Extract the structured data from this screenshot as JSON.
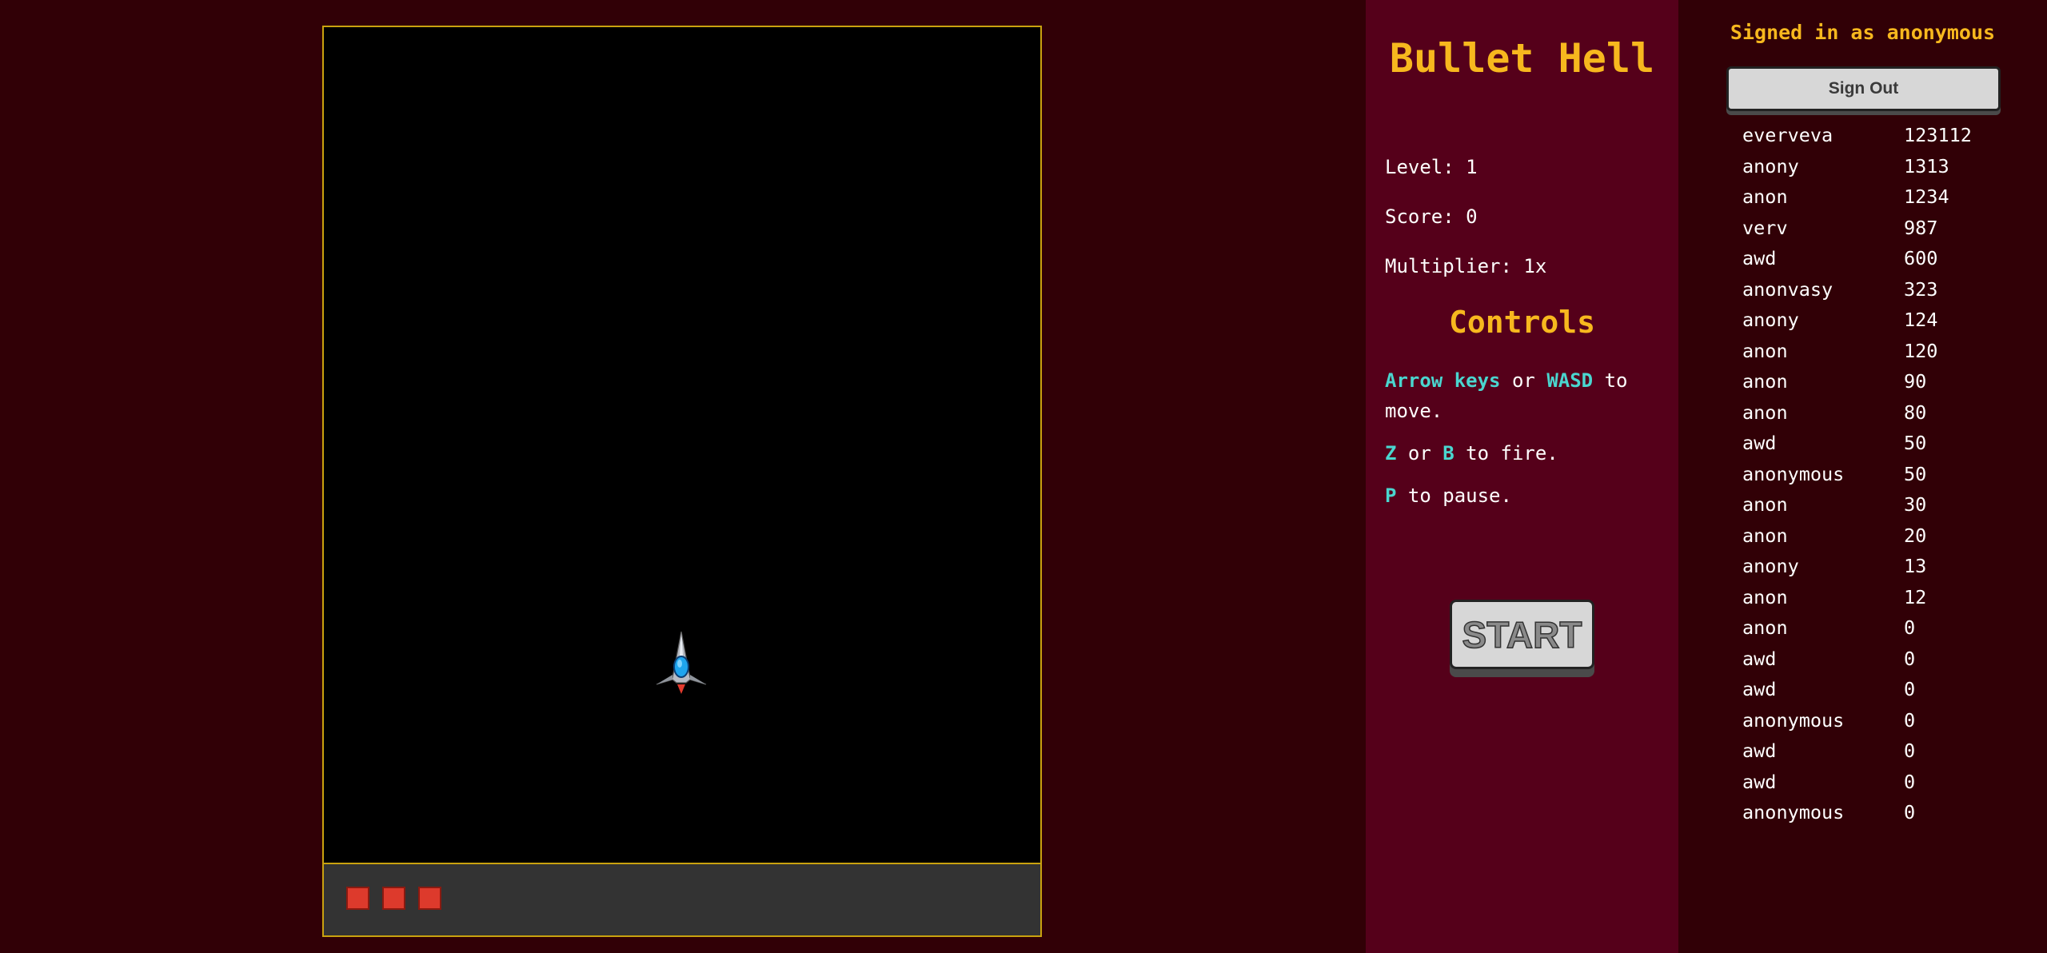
{
  "game": {
    "lives": 3
  },
  "side_panel": {
    "title": "Bullet Hell",
    "level_label": "Level: 1",
    "score_label": "Score: 0",
    "multiplier_label": "Multiplier: 1x",
    "controls_heading": "Controls",
    "controls": {
      "move": {
        "key1": "Arrow keys",
        "or": "or",
        "key2": "WASD",
        "rest": "to move."
      },
      "fire": {
        "key1": "Z",
        "or": "or",
        "key2": "B",
        "rest": "to fire."
      },
      "pause": {
        "key1": "P",
        "rest": "to pause."
      }
    },
    "start_label": "START"
  },
  "account": {
    "signed_in_text": "Signed in as anonymous",
    "sign_out_label": "Sign Out"
  },
  "leaderboard": [
    {
      "name": "everveva",
      "score": "123112"
    },
    {
      "name": "anony",
      "score": "1313"
    },
    {
      "name": "anon",
      "score": "1234"
    },
    {
      "name": "verv",
      "score": "987"
    },
    {
      "name": "awd",
      "score": "600"
    },
    {
      "name": "anonvasy",
      "score": "323"
    },
    {
      "name": "anony",
      "score": "124"
    },
    {
      "name": "anon",
      "score": "120"
    },
    {
      "name": "anon",
      "score": "90"
    },
    {
      "name": "anon",
      "score": "80"
    },
    {
      "name": "awd",
      "score": "50"
    },
    {
      "name": "anonymous",
      "score": "50"
    },
    {
      "name": "anon",
      "score": "30"
    },
    {
      "name": "anon",
      "score": "20"
    },
    {
      "name": "anony",
      "score": "13"
    },
    {
      "name": "anon",
      "score": "12"
    },
    {
      "name": "anon",
      "score": "0"
    },
    {
      "name": "awd",
      "score": "0"
    },
    {
      "name": "awd",
      "score": "0"
    },
    {
      "name": "anonymous",
      "score": "0"
    },
    {
      "name": "awd",
      "score": "0"
    },
    {
      "name": "awd",
      "score": "0"
    },
    {
      "name": "anonymous",
      "score": "0"
    }
  ],
  "colors": {
    "background": "#310006",
    "side_panel": "#55001a",
    "accent_gold": "#f7b81e",
    "key_cyan": "#4ad6cf",
    "frame_border": "#c9a20f",
    "life_red": "#dd3a2c"
  },
  "icons": {
    "player": "spaceship-icon",
    "life": "life-square-icon"
  }
}
